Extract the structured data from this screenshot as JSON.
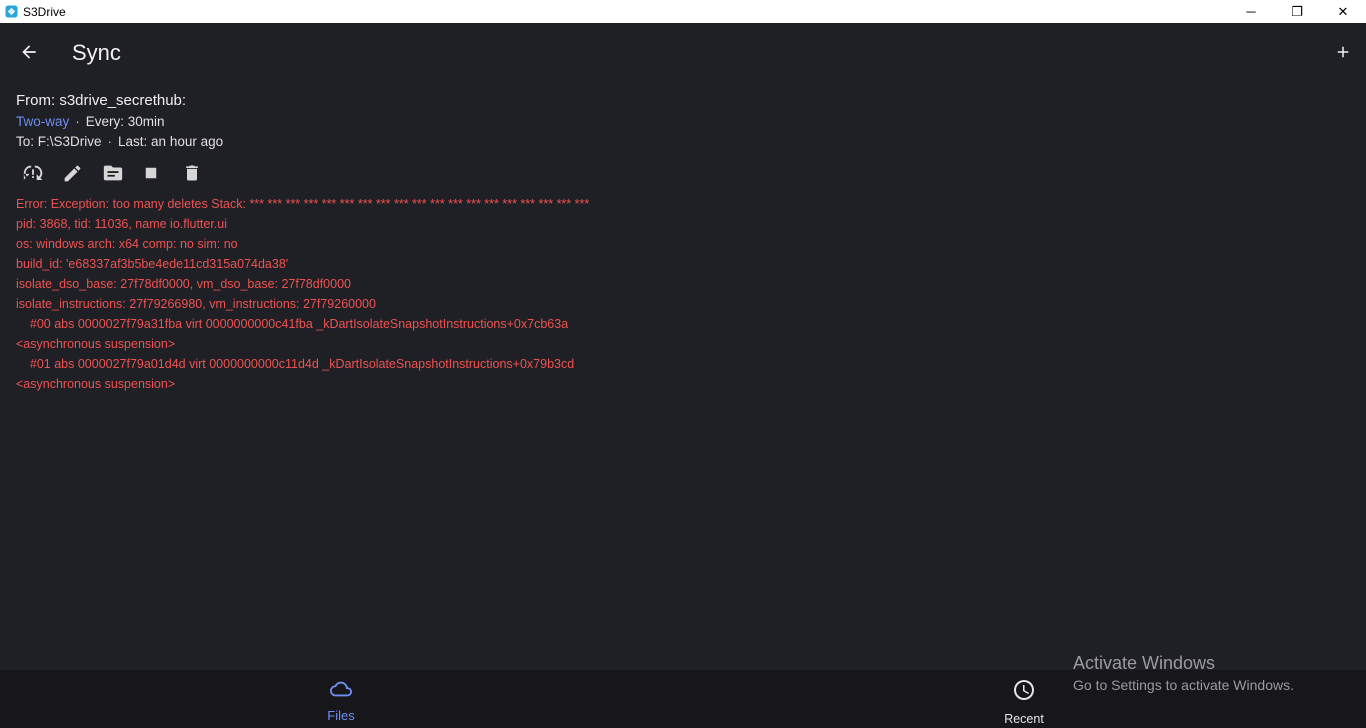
{
  "window": {
    "title": "S3Drive",
    "controls": {
      "minimize": "─",
      "restore": "❐",
      "close": "✕"
    }
  },
  "appbar": {
    "title": "Sync"
  },
  "sync": {
    "from_label": "From: s3drive_secrethub:",
    "mode": "Two-way",
    "interval": "Every: 30min",
    "to_label": "To: F:\\S3Drive",
    "last": "Last: an hour ago",
    "separator": "·"
  },
  "error_lines": [
    "Error: Exception: too many deletes Stack: *** *** *** *** *** *** *** *** *** *** *** *** *** *** *** *** *** *** ***",
    "pid: 3868, tid: 11036, name io.flutter.ui",
    "os: windows arch: x64 comp: no sim: no",
    "build_id: 'e68337af3b5be4ede11cd315a074da38'",
    "isolate_dso_base: 27f78df0000, vm_dso_base: 27f78df0000",
    "isolate_instructions: 27f79266980, vm_instructions: 27f79260000",
    "    #00 abs 0000027f79a31fba virt 0000000000c41fba _kDartIsolateSnapshotInstructions+0x7cb63a",
    "<asynchronous suspension>",
    "    #01 abs 0000027f79a01d4d virt 0000000000c11d4d _kDartIsolateSnapshotInstructions+0x79b3cd",
    "<asynchronous suspension>"
  ],
  "bottom_nav": {
    "files_label": "Files",
    "recent_label": "Recent"
  },
  "watermark": {
    "title": "Activate Windows",
    "subtitle": "Go to Settings to activate Windows."
  },
  "colors": {
    "background": "#1f1f26",
    "accent": "#6f8ff0",
    "error": "#ef5350",
    "nav_background": "#16161b"
  }
}
